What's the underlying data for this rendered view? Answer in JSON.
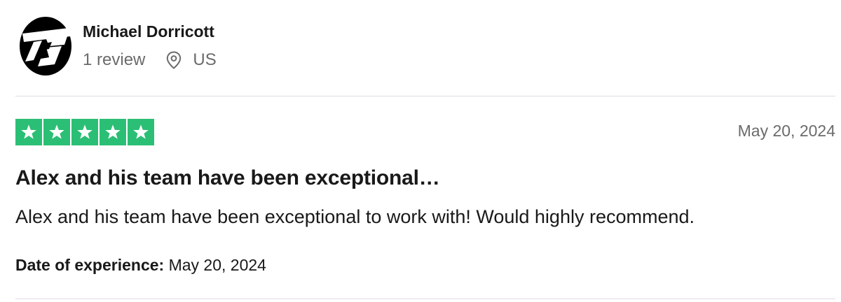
{
  "reviewer": {
    "name": "Michael Dorricott",
    "review_count": "1 review",
    "country": "US",
    "avatar_icon": "ts-logo-icon"
  },
  "review": {
    "rating": 5,
    "rating_max": 5,
    "star_color": "#2bbf75",
    "date": "May 20, 2024",
    "title": "Alex and his team have been exceptional…",
    "body": "Alex and his team have been exceptional to work with! Would highly recommend.",
    "experience_label": "Date of experience:",
    "experience_date": "May 20, 2024"
  },
  "icons": {
    "location": "location-pin-icon",
    "star": "star-icon"
  }
}
